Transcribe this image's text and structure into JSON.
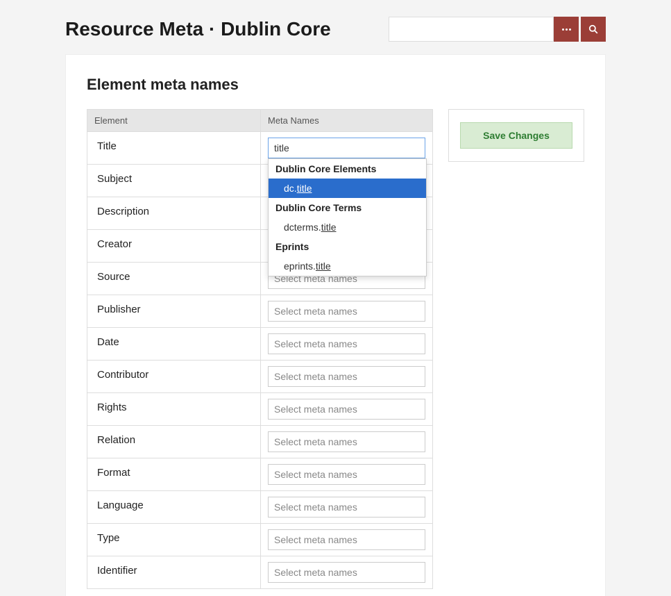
{
  "header": {
    "title": "Resource Meta · Dublin Core",
    "search_placeholder": ""
  },
  "panel": {
    "heading": "Element meta names"
  },
  "table": {
    "headers": {
      "element": "Element",
      "meta_names": "Meta Names"
    },
    "rows": [
      {
        "element": "Title",
        "meta_value": "title",
        "placeholder": "Select meta names",
        "active": true
      },
      {
        "element": "Subject",
        "meta_value": "",
        "placeholder": "Select meta names",
        "active": false
      },
      {
        "element": "Description",
        "meta_value": "",
        "placeholder": "Select meta names",
        "active": false
      },
      {
        "element": "Creator",
        "meta_value": "",
        "placeholder": "Select meta names",
        "active": false
      },
      {
        "element": "Source",
        "meta_value": "",
        "placeholder": "Select meta names",
        "active": false
      },
      {
        "element": "Publisher",
        "meta_value": "",
        "placeholder": "Select meta names",
        "active": false
      },
      {
        "element": "Date",
        "meta_value": "",
        "placeholder": "Select meta names",
        "active": false
      },
      {
        "element": "Contributor",
        "meta_value": "",
        "placeholder": "Select meta names",
        "active": false
      },
      {
        "element": "Rights",
        "meta_value": "",
        "placeholder": "Select meta names",
        "active": false
      },
      {
        "element": "Relation",
        "meta_value": "",
        "placeholder": "Select meta names",
        "active": false
      },
      {
        "element": "Format",
        "meta_value": "",
        "placeholder": "Select meta names",
        "active": false
      },
      {
        "element": "Language",
        "meta_value": "",
        "placeholder": "Select meta names",
        "active": false
      },
      {
        "element": "Type",
        "meta_value": "",
        "placeholder": "Select meta names",
        "active": false
      },
      {
        "element": "Identifier",
        "meta_value": "",
        "placeholder": "Select meta names",
        "active": false
      }
    ]
  },
  "dropdown": {
    "groups": [
      {
        "label": "Dublin Core Elements",
        "items": [
          {
            "prefix": "dc.",
            "match": "title",
            "highlight": true
          }
        ]
      },
      {
        "label": "Dublin Core Terms",
        "items": [
          {
            "prefix": "dcterms.",
            "match": "title",
            "highlight": false
          }
        ]
      },
      {
        "label": "Eprints",
        "items": [
          {
            "prefix": "eprints.",
            "match": "title",
            "highlight": false
          }
        ]
      }
    ]
  },
  "sidebar": {
    "save_label": "Save Changes"
  }
}
